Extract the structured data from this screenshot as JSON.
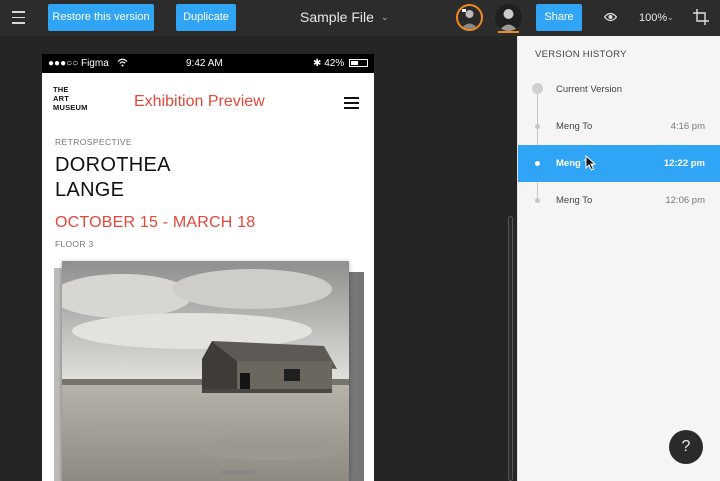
{
  "toolbar": {
    "restore_label": "Restore this version",
    "duplicate_label": "Duplicate",
    "file_title": "Sample File",
    "share_label": "Share",
    "zoom": "100%",
    "icons": [
      "menu-icon",
      "chevron-down-icon",
      "eye-icon",
      "crop-icon"
    ]
  },
  "phone": {
    "statusbar": {
      "carrier": "●●●○○ Figma",
      "time": "9:42 AM",
      "battery": "42%"
    },
    "logo": "THE ART MUSEUM",
    "logo_lines": [
      "THE",
      "ART",
      "MUSEUM"
    ],
    "app_title": "Exhibition Preview",
    "kicker": "RETROSPECTIVE",
    "artist_lines": [
      "DOROTHEA",
      "LANGE"
    ],
    "dates": "OCTOBER 15 - MARCH 18",
    "floor": "FLOOR 3"
  },
  "version_history": {
    "title": "VERSION HISTORY",
    "items": [
      {
        "name": "Current Version",
        "time": "",
        "selected": false
      },
      {
        "name": "Meng To",
        "time": "4:16 pm",
        "selected": false
      },
      {
        "name": "Meng To",
        "time": "12:22 pm",
        "selected": true
      },
      {
        "name": "Meng To",
        "time": "12:06 pm",
        "selected": false
      }
    ]
  },
  "help_label": "?",
  "colors": {
    "accent": "#30a4f5",
    "brand_red": "#e3483a",
    "avatar_ring": "#f08a1f"
  }
}
